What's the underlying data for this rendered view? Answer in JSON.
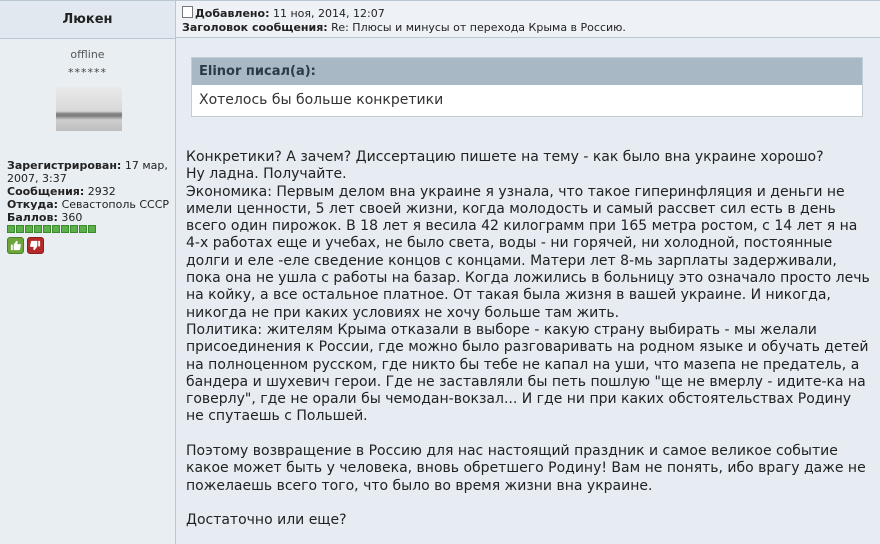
{
  "author": {
    "name": "Люкен",
    "status": "offline",
    "stars": "******",
    "registered_label": "Зарегистрирован:",
    "registered_value": " 17 мар, 2007, 3:37",
    "posts_label": "Сообщения:",
    "posts_value": " 2932",
    "from_label": "Откуда:",
    "from_value": " Севастополь СССР",
    "points_label": "Баллов:",
    "points_value": " 360",
    "reputation_pips": 10
  },
  "post": {
    "added_label": "Добавлено:",
    "added_value": " 11 ноя, 2014, 12:07",
    "subject_label": "Заголовок сообщения:",
    "subject_value": " Re: Плюсы и минусы от перехода Крыма в Россию."
  },
  "quote": {
    "header": "Elinor писал(а):",
    "text": "Хотелось бы больше конкретики"
  },
  "body": {
    "p1": "Конкретики? А зачем? Диссертацию пишете на тему - как было вна украине хорошо?",
    "p2": "Ну ладна. Получайте.",
    "p3": "Экономика: Первым делом вна украине я узнала, что такое гиперинфляция и деньги не имели ценности, 5 лет своей жизни, когда молодость и самый рассвет сил есть в день всего один пирожок. В 18 лет я весила 42 килограмм при 165 метра ростом, с 14 лет я на 4-х работах еще и учебах, не было света, воды - ни горячей, ни холодной, постоянные долги и еле -еле сведение концов с концами. Матери лет 8-мь зарплаты задерживали, пока она не ушла с работы на базар. Когда ложились в больницу это означало просто лечь на койку, а все остальное платное. От такая была жизня в вашей украине. И никогда, никогда не при каких условиях не хочу больше там жить.",
    "p4": "Политика: жителям Крыма отказали в выборе - какую страну выбирать - мы желали присоединения к России, где можно было разговаривать на родном языке и обучать детей на полноценном русском, где никто бы тебе не капал на уши, что мазепа не предатель, а бандера и шухевич герои. Где не заставляли бы петь пошлую \"ще не вмерлу - идите-ка на говерлу\", где не орали бы чемодан-вокзал... И где ни при каких обстоятельствах Родину не спутаешь с Польшей.",
    "p5": "Поэтому возвращение в Россию для нас настоящий праздник и самое великое событие какое может быть у человека, вновь обретшего Родину! Вам не понять, ибо врагу даже не пожелаешь всего того, что было во время жизни вна украине.",
    "p6": "Достаточно или еще?"
  },
  "colors": {
    "left_bg": "#e9eef3",
    "right_bg": "#e6ecf2",
    "quote_header_bg": "#a9b8c5",
    "vote_up": "#6ea53b",
    "vote_down": "#b42a2a"
  },
  "icons": {
    "post_icon": "document-icon",
    "vote_up": "thumbs-up-icon",
    "vote_down": "thumbs-down-icon"
  }
}
